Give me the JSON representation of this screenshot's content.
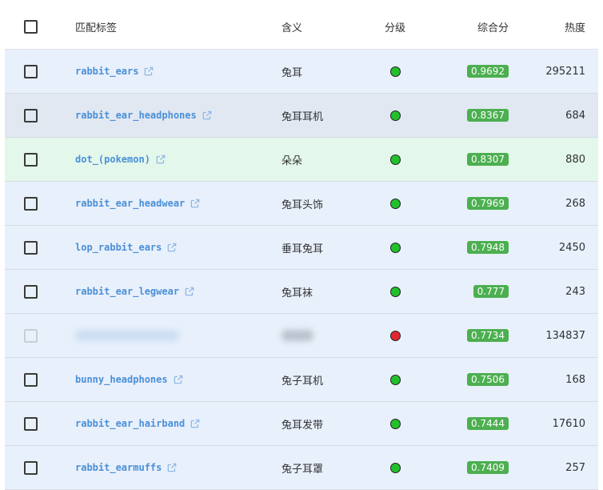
{
  "header": {
    "tag": "匹配标签",
    "meaning": "含义",
    "grade": "分级",
    "score": "综合分",
    "heat": "热度"
  },
  "colors": {
    "row_default": "#e8f0fb",
    "row_hover": "#e1e8f2",
    "row_green": "#e3f7ea",
    "badge": "#4caf50",
    "dot_green": "#22c02b",
    "dot_red": "#e2262f",
    "link": "#4a8fd8"
  },
  "rows": [
    {
      "tag": "rabbit_ears",
      "meaning": "兔耳",
      "grade": "green",
      "score": "0.9692",
      "heat": "295211",
      "bg": "#e8f0fb",
      "blurred": false
    },
    {
      "tag": "rabbit_ear_headphones",
      "meaning": "兔耳耳机",
      "grade": "green",
      "score": "0.8367",
      "heat": "684",
      "bg": "#e1e8f2",
      "blurred": false
    },
    {
      "tag": "dot_(pokemon)",
      "meaning": "朵朵",
      "grade": "green",
      "score": "0.8307",
      "heat": "880",
      "bg": "#e3f7ea",
      "blurred": false
    },
    {
      "tag": "rabbit_ear_headwear",
      "meaning": "兔耳头饰",
      "grade": "green",
      "score": "0.7969",
      "heat": "268",
      "bg": "#e8f0fb",
      "blurred": false
    },
    {
      "tag": "lop_rabbit_ears",
      "meaning": "垂耳兔耳",
      "grade": "green",
      "score": "0.7948",
      "heat": "2450",
      "bg": "#e8f0fb",
      "blurred": false
    },
    {
      "tag": "rabbit_ear_legwear",
      "meaning": "兔耳袜",
      "grade": "green",
      "score": "0.777",
      "heat": "243",
      "bg": "#e8f0fb",
      "blurred": false
    },
    {
      "tag": "",
      "meaning": "",
      "grade": "red",
      "score": "0.7734",
      "heat": "134837",
      "bg": "#e8f0fb",
      "blurred": true
    },
    {
      "tag": "bunny_headphones",
      "meaning": "兔子耳机",
      "grade": "green",
      "score": "0.7506",
      "heat": "168",
      "bg": "#e8f0fb",
      "blurred": false
    },
    {
      "tag": "rabbit_ear_hairband",
      "meaning": "兔耳发带",
      "grade": "green",
      "score": "0.7444",
      "heat": "17610",
      "bg": "#e8f0fb",
      "blurred": false
    },
    {
      "tag": "rabbit_earmuffs",
      "meaning": "兔子耳罩",
      "grade": "green",
      "score": "0.7409",
      "heat": "257",
      "bg": "#e8f0fb",
      "blurred": false
    }
  ]
}
